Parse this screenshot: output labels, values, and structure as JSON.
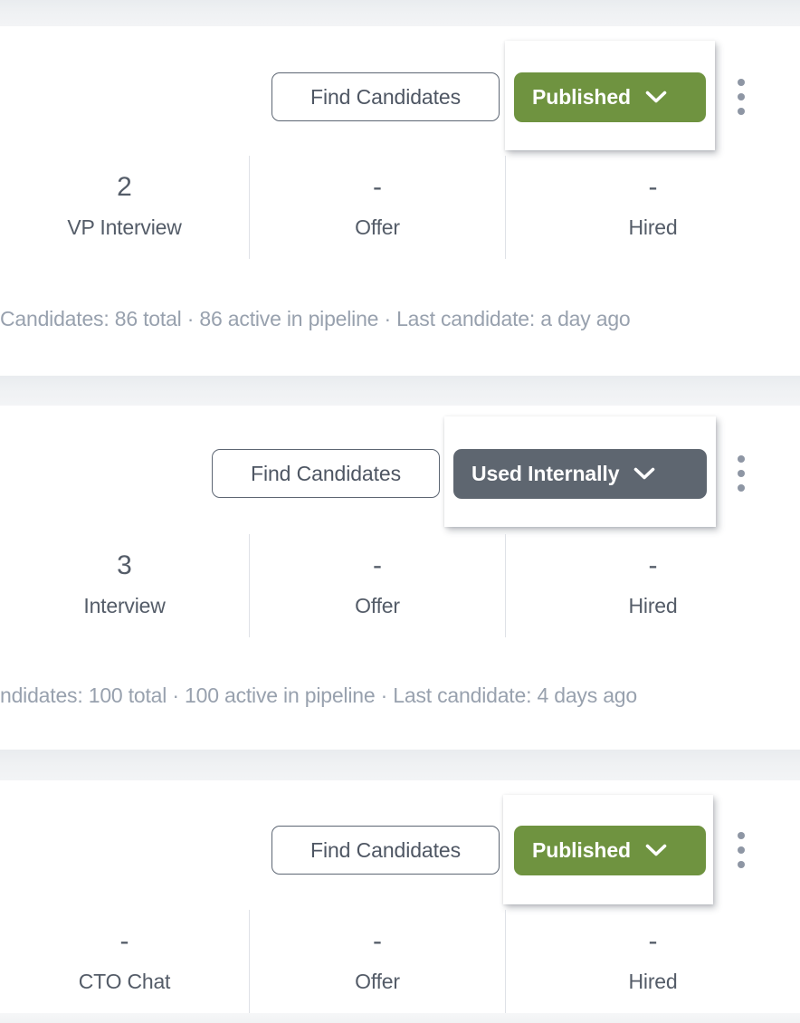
{
  "page": {
    "background": "#ffffff",
    "gap_band_color": "#eff1f3",
    "text_dark": "#545c68",
    "text_muted": "#98a1ae",
    "divider_color": "#dfe2e7"
  },
  "colors": {
    "published_green": "#6f9340",
    "used_internally_slate": "#5e6670",
    "outline_border": "#5d6673",
    "kebab_dot": "#8e96a4"
  },
  "cards": [
    {
      "find_candidates_label": "Find Candidates",
      "status_label": "Published",
      "status_color": "#6f9340",
      "kebab_icon": "more-vertical-icon",
      "chevron_icon": "chevron-down-icon",
      "stats": [
        {
          "value": "2",
          "label": "VP Interview"
        },
        {
          "value": "-",
          "label": "Offer"
        },
        {
          "value": "-",
          "label": "Hired"
        }
      ],
      "footer": "Candidates: 86 total · 86 active in pipeline · Last candidate: a day ago"
    },
    {
      "find_candidates_label": "Find Candidates",
      "status_label": "Used Internally",
      "status_color": "#5e6670",
      "kebab_icon": "more-vertical-icon",
      "chevron_icon": "chevron-down-icon",
      "stats": [
        {
          "value": "3",
          "label": "Interview"
        },
        {
          "value": "-",
          "label": "Offer"
        },
        {
          "value": "-",
          "label": "Hired"
        }
      ],
      "footer": "ndidates: 100 total · 100 active in pipeline · Last candidate: 4 days ago"
    },
    {
      "find_candidates_label": "Find Candidates",
      "status_label": "Published",
      "status_color": "#6f9340",
      "kebab_icon": "more-vertical-icon",
      "chevron_icon": "chevron-down-icon",
      "stats": [
        {
          "value": "-",
          "label": "CTO Chat"
        },
        {
          "value": "-",
          "label": "Offer"
        },
        {
          "value": "-",
          "label": "Hired"
        }
      ],
      "footer": ""
    }
  ]
}
